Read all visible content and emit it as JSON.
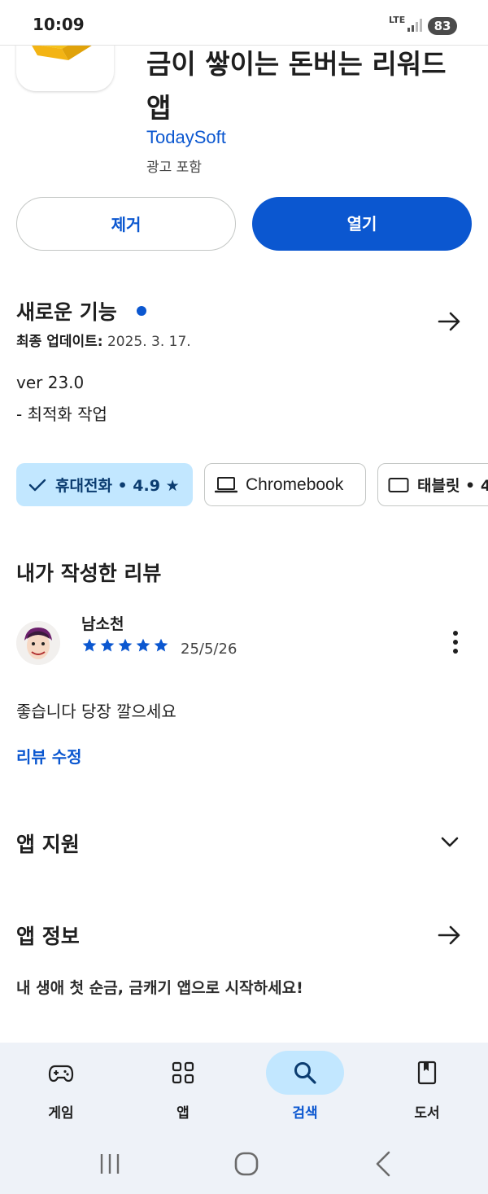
{
  "status_bar": {
    "time": "10:09",
    "network": "LTE",
    "battery": "83"
  },
  "app": {
    "title": "금이 쌓이는 돈버는 리워드 앱",
    "developer": "TodaySoft",
    "ads": "광고 포함",
    "remove_label": "제거",
    "open_label": "열기"
  },
  "whats_new": {
    "title": "새로운 기능",
    "updated_label": "최종 업데이트:",
    "updated_date": "2025. 3. 17.",
    "version": "ver 23.0",
    "notes": "- 최적화 작업"
  },
  "device_chips": [
    {
      "label": "휴대전화 • 4.9 ★",
      "icon": "check-icon",
      "selected": true
    },
    {
      "label": "Chromebook",
      "icon": "laptop-icon",
      "selected": false
    },
    {
      "label": "태블릿 • 4",
      "icon": "tablet-icon",
      "selected": false
    }
  ],
  "my_review": {
    "title": "내가 작성한 리뷰",
    "reviewer": "남소천",
    "rating": 5,
    "date": "25/5/26",
    "text": "좋습니다 당장 깔으세요",
    "edit_label": "리뷰 수정"
  },
  "app_support": {
    "title": "앱 지원"
  },
  "app_info": {
    "title": "앱 정보",
    "description": "내 생애 첫 순금, 금캐기 앱으로 시작하세요!"
  },
  "bottom_nav": [
    {
      "label": "게임",
      "icon": "gamepad-icon",
      "active": false
    },
    {
      "label": "앱",
      "icon": "apps-grid-icon",
      "active": false
    },
    {
      "label": "검색",
      "icon": "search-icon",
      "active": true
    },
    {
      "label": "도서",
      "icon": "book-icon",
      "active": false
    }
  ],
  "colors": {
    "accent": "#0b57d0",
    "chip_selected": "#c2e7ff",
    "nav_bg": "#eef2f8"
  }
}
